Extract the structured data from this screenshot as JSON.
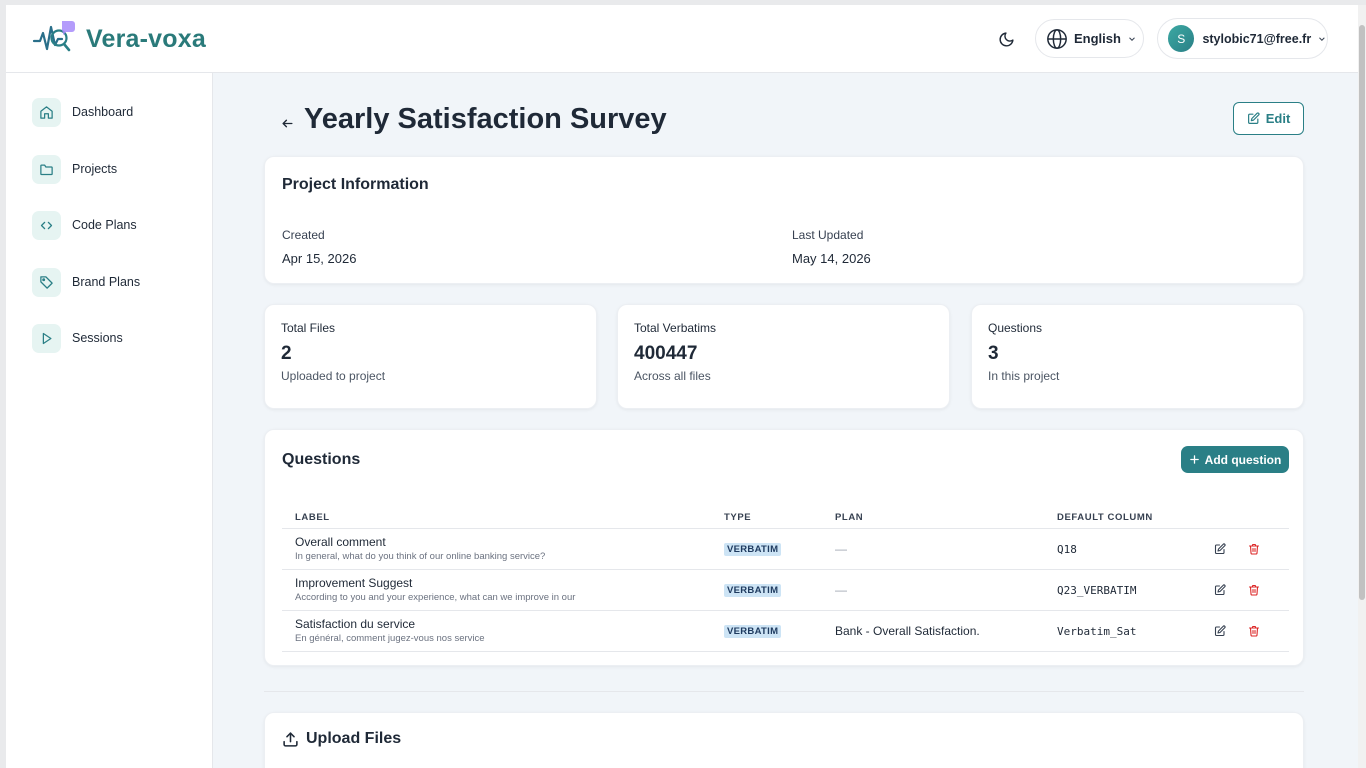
{
  "app": {
    "name": "Vera-voxa"
  },
  "header": {
    "language": "English",
    "user": {
      "initial": "S",
      "email": "stylobic71@free.fr"
    }
  },
  "sidebar": {
    "items": [
      {
        "label": "Dashboard",
        "icon": "home-icon"
      },
      {
        "label": "Projects",
        "icon": "folder-icon"
      },
      {
        "label": "Code Plans",
        "icon": "code-icon"
      },
      {
        "label": "Brand Plans",
        "icon": "tag-icon"
      },
      {
        "label": "Sessions",
        "icon": "play-icon"
      }
    ]
  },
  "page": {
    "title": "Yearly Satisfaction Survey",
    "edit_label": "Edit"
  },
  "project_info": {
    "title": "Project Information",
    "created_label": "Created",
    "created_value": "Apr 15, 2026",
    "updated_label": "Last Updated",
    "updated_value": "May 14, 2026"
  },
  "stats": [
    {
      "label": "Total Files",
      "value": "2",
      "sub": "Uploaded to project"
    },
    {
      "label": "Total Verbatims",
      "value": "400447",
      "sub": "Across all files"
    },
    {
      "label": "Questions",
      "value": "3",
      "sub": "In this project"
    }
  ],
  "questions": {
    "title": "Questions",
    "add_label": "Add question",
    "columns": {
      "label": "LABEL",
      "type": "TYPE",
      "plan": "PLAN",
      "default_column": "DEFAULT COLUMN"
    },
    "rows": [
      {
        "label": "Overall comment",
        "sub": "In general, what do you think of our online banking service?",
        "type": "VERBATIM",
        "plan": "—",
        "column": "Q18"
      },
      {
        "label": "Improvement Suggest",
        "sub": "According to you and your experience, what can we improve in our",
        "type": "VERBATIM",
        "plan": "—",
        "column": "Q23_VERBATIM"
      },
      {
        "label": "Satisfaction du service",
        "sub": "En général, comment jugez-vous nos service",
        "type": "VERBATIM",
        "plan": "Bank - Overall Satisfaction.",
        "column": "Verbatim_Sat"
      }
    ]
  },
  "upload": {
    "title": "Upload Files"
  },
  "colors": {
    "accent": "#2a7f86",
    "badge_bg": "#cde4f5",
    "delete": "#dc2626"
  }
}
